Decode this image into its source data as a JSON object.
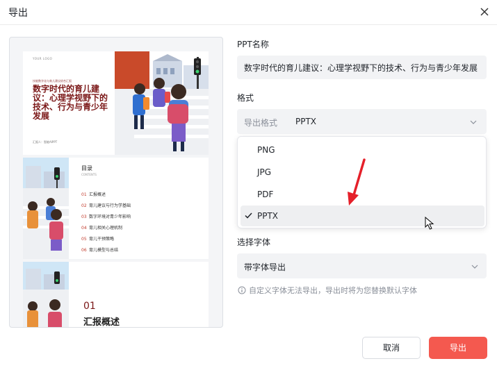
{
  "dialog": {
    "title": "导出"
  },
  "preview": {
    "slide1": {
      "logo": "YOUR LOGO",
      "small_heading": "技能数字化与育儿建议综合汇报",
      "title": "数字时代的育儿建议：心理学视野下的技术、行为与青少年发展",
      "reporter": "汇报人：智能AIPPT"
    },
    "slide2": {
      "title": "目录",
      "subtitle": "CONTENTS",
      "items": [
        {
          "num": "01",
          "text": "汇报概述"
        },
        {
          "num": "02",
          "text": "育儿建议与行为学基础"
        },
        {
          "num": "03",
          "text": "数字环境对青少年影响"
        },
        {
          "num": "04",
          "text": "育儿相关心理机制"
        },
        {
          "num": "05",
          "text": "育儿干预策略"
        },
        {
          "num": "06",
          "text": "育儿模型与总结"
        }
      ]
    },
    "slide3": {
      "num": "01",
      "title": "汇报概述"
    }
  },
  "form": {
    "name_label": "PPT名称",
    "name_value": "数字时代的育儿建议：心理学视野下的技术、行为与青少年发展",
    "format_section_label": "格式",
    "format_field_label": "导出格式",
    "format_value": "PPTX",
    "format_options": [
      {
        "label": "PNG",
        "selected": false
      },
      {
        "label": "JPG",
        "selected": false
      },
      {
        "label": "PDF",
        "selected": false
      },
      {
        "label": "PPTX",
        "selected": true
      }
    ],
    "font_section_label": "选择字体",
    "font_value": "带字体导出",
    "hint": "自定义字体无法导出，导出时将为您替换默认字体"
  },
  "buttons": {
    "cancel": "取消",
    "export": "导出"
  },
  "colors": {
    "accent": "#f4594f",
    "brand_dark": "#7a1616",
    "annotation_arrow": "#e5202a"
  }
}
